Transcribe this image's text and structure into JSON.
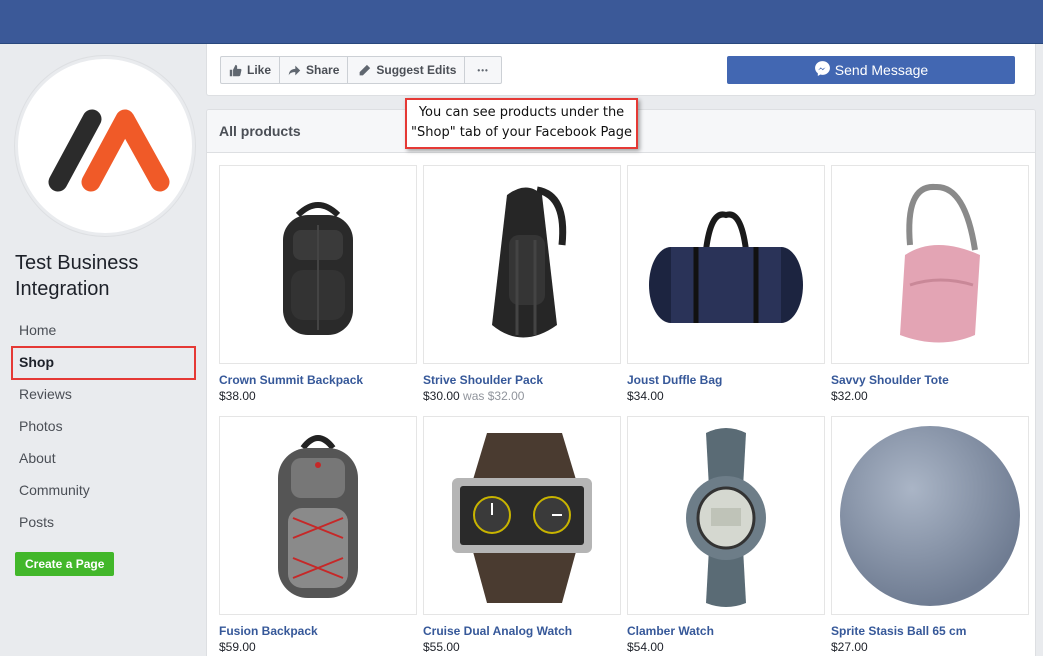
{
  "page": {
    "name": "Test Business Integration",
    "brand_colors": {
      "logo_dark": "#2b2b2b",
      "logo_orange": "#f05a28",
      "header_blue": "#3b5998",
      "highlight_red": "#e53935"
    }
  },
  "nav": {
    "items": [
      "Home",
      "Shop",
      "Reviews",
      "Photos",
      "About",
      "Community",
      "Posts"
    ],
    "active": "Shop",
    "create_page": "Create a Page"
  },
  "actions": {
    "like": "Like",
    "share": "Share",
    "suggest_edits": "Suggest Edits",
    "more": "•••",
    "send_message": "Send Message",
    "icons": [
      "thumbs-up-icon",
      "share-arrow-icon",
      "pencil-icon",
      "more-dots-icon",
      "messenger-icon"
    ]
  },
  "annotation": {
    "line1": "You can see products under the",
    "line2": "\"Shop\" tab of your Facebook Page"
  },
  "products": {
    "header": "All products",
    "items": [
      {
        "name": "Crown Summit Backpack",
        "price": "$38.00",
        "was": ""
      },
      {
        "name": "Strive Shoulder Pack",
        "price": "$30.00",
        "was": "was $32.00"
      },
      {
        "name": "Joust Duffle Bag",
        "price": "$34.00",
        "was": ""
      },
      {
        "name": "Savvy Shoulder Tote",
        "price": "$32.00",
        "was": ""
      },
      {
        "name": "Fusion Backpack",
        "price": "$59.00",
        "was": ""
      },
      {
        "name": "Cruise Dual Analog Watch",
        "price": "$55.00",
        "was": ""
      },
      {
        "name": "Clamber Watch",
        "price": "$54.00",
        "was": ""
      },
      {
        "name": "Sprite Stasis Ball 65 cm",
        "price": "$27.00",
        "was": ""
      }
    ]
  }
}
